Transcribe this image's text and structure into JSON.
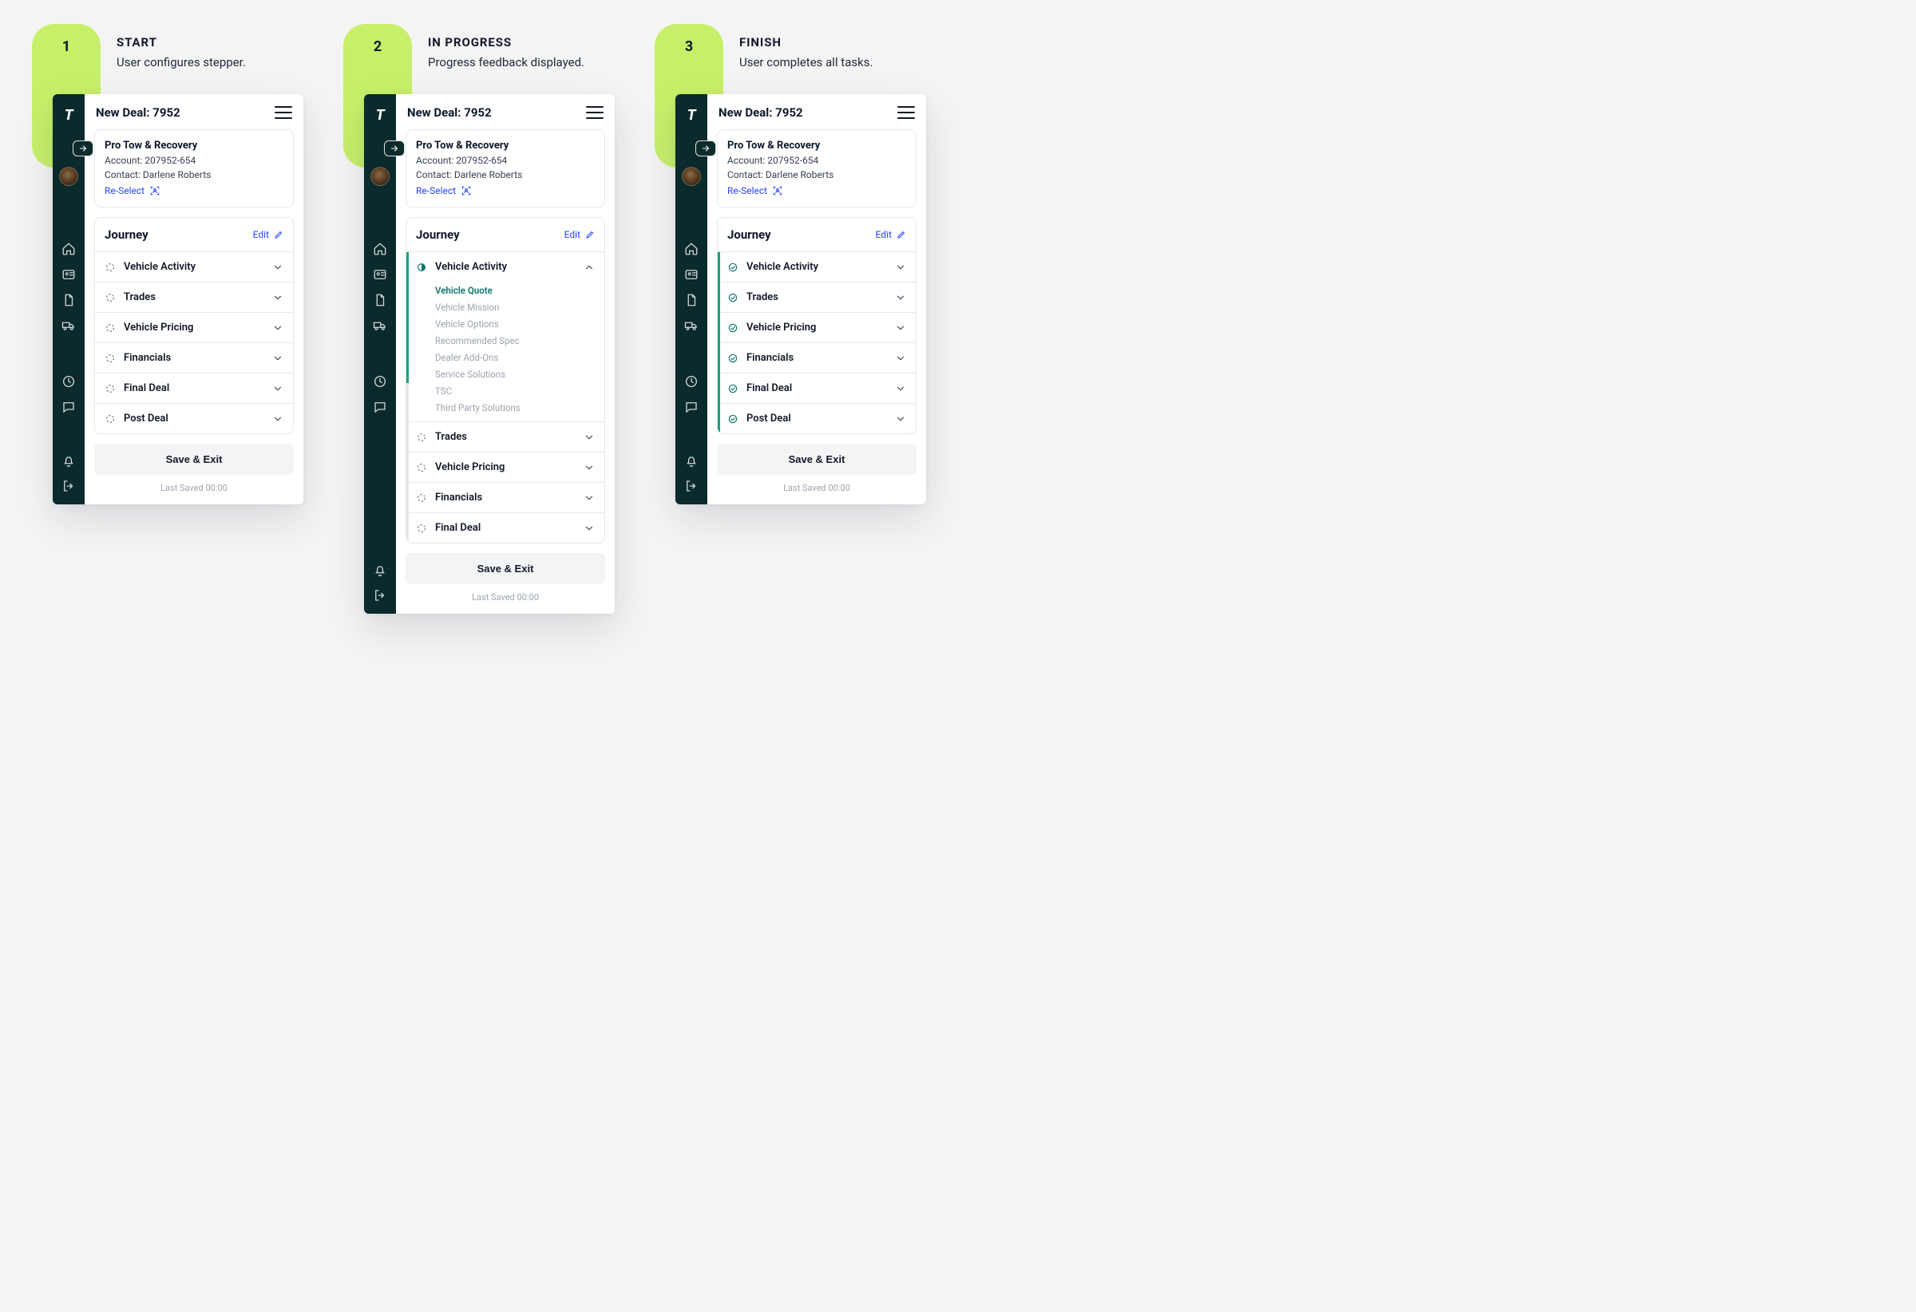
{
  "stages": [
    {
      "num": "1",
      "title": "START",
      "sub": "User configures stepper."
    },
    {
      "num": "2",
      "title": "IN PROGRESS",
      "sub": "Progress feedback displayed."
    },
    {
      "num": "3",
      "title": "FINISH",
      "sub": "User completes all tasks."
    }
  ],
  "app": {
    "logo": "T",
    "deal_title": "New Deal: 7952"
  },
  "company": {
    "name": "Pro Tow & Recovery",
    "account_label": "Account: 207952-654",
    "contact_label": "Contact: Darlene Roberts",
    "reselect": "Re-Select"
  },
  "journey": {
    "heading": "Journey",
    "edit": "Edit",
    "start_items": [
      {
        "label": "Vehicle Activity"
      },
      {
        "label": "Trades"
      },
      {
        "label": "Vehicle Pricing"
      },
      {
        "label": "Financials"
      },
      {
        "label": "Final Deal"
      },
      {
        "label": "Post Deal"
      }
    ],
    "progress_items": [
      {
        "label": "Vehicle Activity",
        "expanded": true,
        "sub": [
          "Vehicle Quote",
          "Vehicle Mission",
          "Vehicle Options",
          "Recommended Spec",
          "Dealer Add-Ons",
          "Service Solutions",
          "TSC",
          "Third Party Solutions"
        ]
      },
      {
        "label": "Trades"
      },
      {
        "label": "Vehicle Pricing"
      },
      {
        "label": "Financials"
      },
      {
        "label": "Final Deal"
      }
    ],
    "finish_items": [
      {
        "label": "Vehicle Activity"
      },
      {
        "label": "Trades"
      },
      {
        "label": "Vehicle Pricing"
      },
      {
        "label": "Financials"
      },
      {
        "label": "Final Deal"
      },
      {
        "label": "Post Deal"
      }
    ]
  },
  "footer": {
    "save": "Save & Exit",
    "last": "Last Saved 00:00"
  }
}
